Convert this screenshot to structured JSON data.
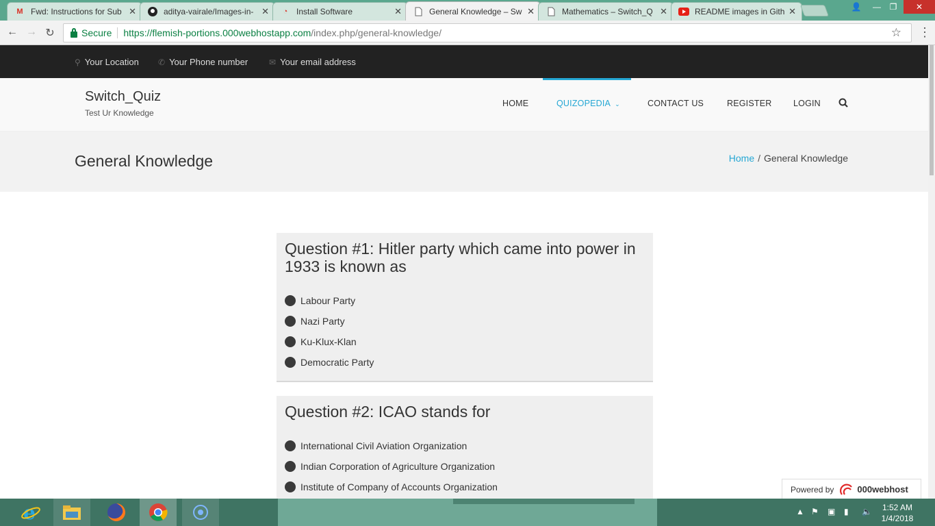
{
  "browser": {
    "tabs": [
      {
        "title": "Fwd: Instructions for Sub",
        "icon": "gmail-icon"
      },
      {
        "title": "aditya-vairale/Images-in-",
        "icon": "github-icon"
      },
      {
        "title": "Install Software",
        "icon": "000webhost-icon"
      },
      {
        "title": "General Knowledge – Sw",
        "icon": "page-icon",
        "active": true
      },
      {
        "title": "Mathematics – Switch_Q",
        "icon": "page-icon"
      },
      {
        "title": "README images in Githu",
        "icon": "youtube-icon"
      }
    ],
    "secure_label": "Secure",
    "url_scheme_host": "https://flemish-portions.000webhostapp.com",
    "url_path": "/index.php/general-knowledge/"
  },
  "topbar": {
    "location": "Your Location",
    "phone": "Your Phone number",
    "email": "Your email address"
  },
  "header": {
    "site_name": "Switch_Quiz",
    "tagline": "Test Ur Knowledge",
    "nav": {
      "home": "HOME",
      "quizopedia": "QUIZOPEDIA",
      "contact": "CONTACT US",
      "register": "REGISTER",
      "login": "LOGIN"
    }
  },
  "page": {
    "title": "General Knowledge",
    "breadcrumb_home": "Home",
    "breadcrumb_sep": "/",
    "breadcrumb_current": "General Knowledge"
  },
  "questions": [
    {
      "title": "Question #1: Hitler party which came into power in 1933 is known as",
      "options": [
        "Labour Party",
        "Nazi Party",
        "Ku-Klux-Klan",
        "Democratic Party"
      ]
    },
    {
      "title": "Question #2: ICAO stands for",
      "options": [
        "International Civil Aviation Organization",
        "Indian Corporation of Agriculture Organization",
        "Institute of Company of Accounts Organization"
      ]
    }
  ],
  "powered": {
    "label": "Powered by",
    "brand": "000webhost"
  },
  "taskbar": {
    "time": "1:52 AM",
    "date": "1/4/2018"
  },
  "colors": {
    "accent": "#25a7d4",
    "topbar": "#222222",
    "taskbar": "#3f7463",
    "tabstrip": "#5aa78e"
  }
}
